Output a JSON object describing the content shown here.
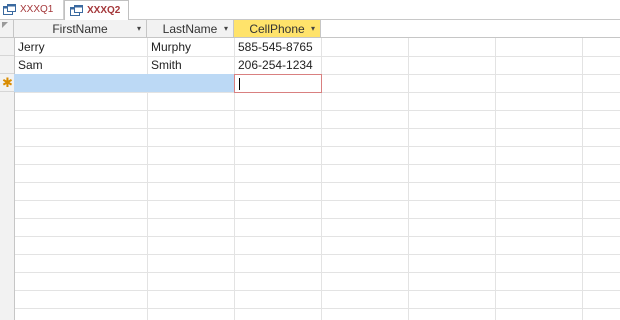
{
  "tabs": [
    {
      "label": "XXXQ1",
      "icon": "query-icon",
      "active": false
    },
    {
      "label": "XXXQ2",
      "icon": "query-icon",
      "active": true
    }
  ],
  "columns": [
    {
      "label": "FirstName",
      "dropdown": "▾"
    },
    {
      "label": "LastName",
      "dropdown": "▾"
    },
    {
      "label": "CellPhone",
      "dropdown": "▾",
      "selected": true
    }
  ],
  "rows": [
    {
      "FirstName": "Jerry",
      "LastName": "Murphy",
      "CellPhone": "585-545-8765"
    },
    {
      "FirstName": "Sam",
      "LastName": "Smith",
      "CellPhone": "206-254-1234"
    }
  ],
  "new_record_marker": "✱",
  "colors": {
    "accent_tab": "#a4373a",
    "selected_header": "#ffe36b",
    "new_row_highlight": "#bcd9f5"
  }
}
